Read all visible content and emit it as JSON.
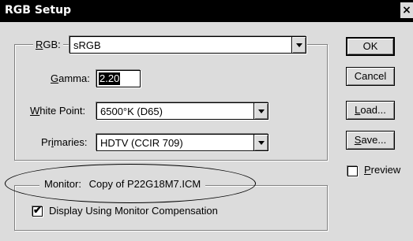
{
  "window": {
    "title": "RGB Setup",
    "close_glyph": "×"
  },
  "rgb": {
    "label_u": "R",
    "label_rest": "GB:",
    "value": "sRGB"
  },
  "gamma": {
    "label_u": "G",
    "label_rest": "amma:",
    "value": "2.20"
  },
  "white_point": {
    "label_u": "W",
    "label_rest": "hite Point:",
    "value": "6500°K (D65)"
  },
  "primaries": {
    "label_pre": "Pr",
    "label_u": "i",
    "label_rest": "maries:",
    "value": "HDTV (CCIR 709)"
  },
  "monitor": {
    "label": "Monitor:",
    "value": "Copy of P22G18M7.ICM",
    "compensation_label": "Display Using Monitor Compensation",
    "compensation_checked": true
  },
  "buttons": {
    "ok": "OK",
    "cancel": "Cancel",
    "load_u": "L",
    "load_rest": "oad...",
    "save_u": "S",
    "save_rest": "ave..."
  },
  "preview": {
    "label_u": "P",
    "label_rest": "review",
    "checked": false
  },
  "icons": {
    "dropdown": "chevron-down-icon",
    "check": "check-icon"
  }
}
